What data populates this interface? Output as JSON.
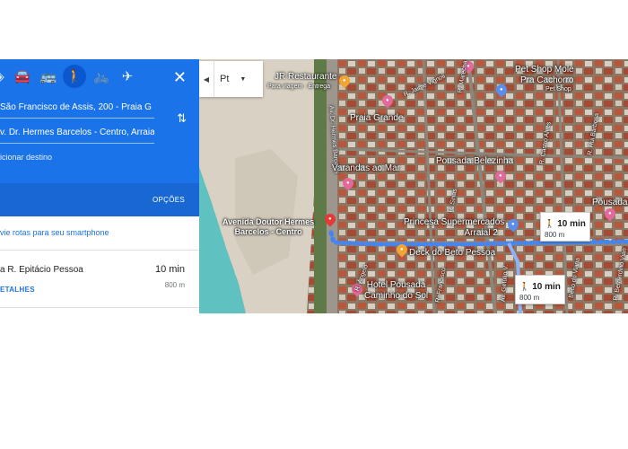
{
  "panel": {
    "close_icon": "close-icon",
    "modes": [
      {
        "name": "best-route",
        "glyph": "◈"
      },
      {
        "name": "driving",
        "glyph": "🚘"
      },
      {
        "name": "transit",
        "glyph": "🚌"
      },
      {
        "name": "walking",
        "glyph": "🚶"
      },
      {
        "name": "cycling",
        "glyph": "🚲"
      },
      {
        "name": "flights",
        "glyph": "✈"
      }
    ],
    "origin": "São Francisco de Assis, 200 - Praia G",
    "destination": "v. Dr. Hermes Barcelos - Centro, Arraia",
    "add_destination": "icionar destino",
    "options": "OPÇÕES",
    "send_to_phone": "vie rotas para seu smartphone",
    "route": {
      "via": "a R. Epitácio Pessoa",
      "time": "10 min",
      "distance": "800 m",
      "details": "ETALHES"
    }
  },
  "map": {
    "language": "Pt",
    "labels": {
      "jr_restaurante": "JR Restaurante",
      "para_viagem": "Para viagem · Entrega",
      "jaime_vignoli": "R. Jaime Vignoli",
      "r_marechal": "R. Marecha",
      "pet_shop": "Pet Shop Mole",
      "pra_cachorro": "Pra Cachorro",
      "pet_shop_cat": "Pet Shop",
      "praia_grande": "Praia Grande",
      "hermes_barcelos": "Av. Dr. Hermes Barcelos",
      "varandas": "Varandas ao Mar",
      "pousada_belezinha": "Pousada Belezinha",
      "castro_alves": "R. Castro Alves",
      "rui_barbosa": "R. Rui Barbosa",
      "pousada_right": "Pousada",
      "av_sinas": "R. Sinas",
      "avenida_line1": "Avenida Doutor Hermes",
      "avenida_line2": "Barcelos - Centro",
      "princesa_line1": "Princesa Supermercados",
      "princesa_line2": "Arraial 2",
      "deck": "Deck do Beto Pessoa",
      "hotel_line1": "Hotel Pousada",
      "hotel_line2": "Caminho do Sol",
      "francisco": "R. Francisco",
      "getulio": "Av. Getúlio V.",
      "beco": "Beco do Viana",
      "bernardino": "R. Bernardino Vian",
      "anglo": "R. Ângelo"
    },
    "time_cards": [
      {
        "time": "10 min",
        "distance": "800 m"
      },
      {
        "time": "10 min",
        "distance": "800 m"
      }
    ]
  },
  "colors": {
    "panel_blue": "#1a73e8",
    "route_blue": "#4285f4",
    "sea": "#5fc2c0"
  }
}
